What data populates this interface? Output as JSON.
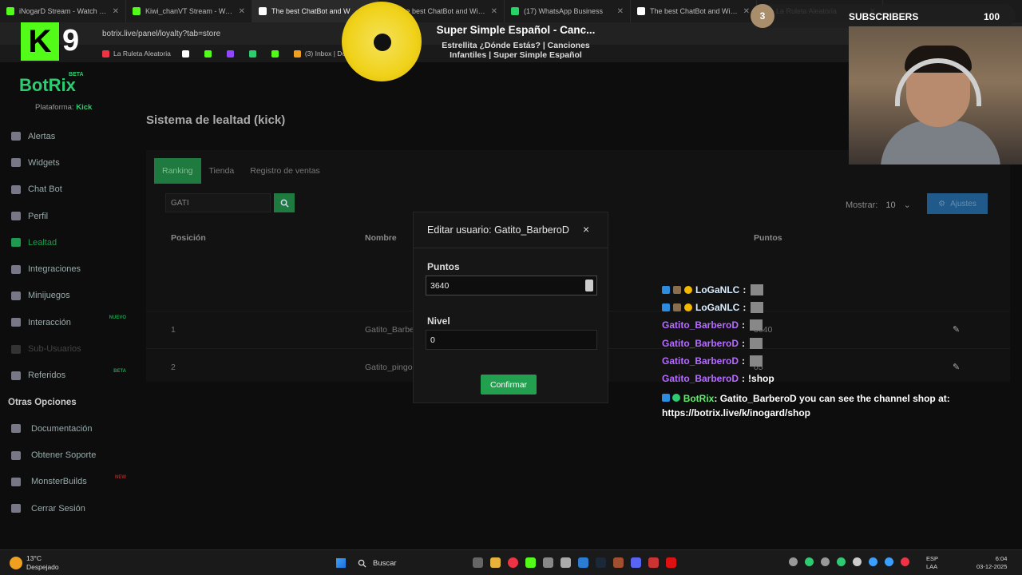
{
  "browser": {
    "tabs": [
      {
        "label": "iNogarD Stream - Watch Live o",
        "color": "#53fc18"
      },
      {
        "label": "Kiwi_chanVT Stream - Watch Li",
        "color": "#53fc18"
      },
      {
        "label": "The best ChatBot and W",
        "color": "#ffffff",
        "active": true
      },
      {
        "label": "The best ChatBot and Widgets",
        "color": "#ffffff"
      },
      {
        "label": "(17) WhatsApp Business",
        "color": "#25d366"
      },
      {
        "label": "The best ChatBot and Widge",
        "color": "#ffffff"
      },
      {
        "label": "La Ruleta Aleatoria",
        "color": "#e34"
      }
    ],
    "url": "botrix.live/panel/loyalty?tab=store",
    "bookmarks": [
      {
        "label": "La Ruleta Aleatoria",
        "color": "#e34"
      },
      {
        "label": "",
        "color": "#fff"
      },
      {
        "label": "",
        "color": "#53fc18"
      },
      {
        "label": "",
        "color": "#9146ff"
      },
      {
        "label": "",
        "color": "#2ecc71"
      },
      {
        "label": "",
        "color": "#53fc18"
      },
      {
        "label": "(3) Inbox | Donoclip",
        "color": "#f0a020"
      }
    ]
  },
  "sidebar": {
    "logo_letter": "K",
    "logo_number": "9",
    "brand": "BotRix",
    "beta": "BETA",
    "platform_label": "Plataforma:",
    "platform_value": "Kick",
    "items": [
      {
        "label": "Alertas",
        "badge": ""
      },
      {
        "label": "Widgets",
        "badge": ""
      },
      {
        "label": "Chat Bot",
        "badge": ""
      },
      {
        "label": "Perfil",
        "badge": ""
      },
      {
        "label": "Lealtad",
        "badge": ""
      },
      {
        "label": "Integraciones",
        "badge": ""
      },
      {
        "label": "Minijuegos",
        "badge": ""
      },
      {
        "label": "Interacción",
        "badge": "NUEVO"
      },
      {
        "label": "Sub-Usuarios",
        "badge": ""
      },
      {
        "label": "Referidos",
        "badge": "BETA"
      }
    ],
    "other_title": "Otras Opciones",
    "other_items": [
      {
        "label": "Documentación",
        "badge": ""
      },
      {
        "label": "Obtener Soporte",
        "badge": ""
      },
      {
        "label": "MonsterBuilds",
        "badge": "NEW"
      },
      {
        "label": "Cerrar Sesión",
        "badge": ""
      }
    ]
  },
  "main": {
    "title": "Sistema de lealtad (kick)",
    "tabs": [
      "Ranking",
      "Tienda",
      "Registro de ventas"
    ],
    "search_value": "GATI",
    "show_label": "Mostrar:",
    "show_value": "10",
    "settings_label": "Ajustes",
    "columns": [
      "Posición",
      "Nombre",
      "Puntos"
    ],
    "rows": [
      {
        "position": "1",
        "name": "Gatito_Barbe",
        "points": "3640"
      },
      {
        "position": "2",
        "name": "Gatito_pingo",
        "points": "05"
      }
    ]
  },
  "modal": {
    "title": "Editar usuario: Gatito_BarberoD",
    "close": "×",
    "points_label": "Puntos",
    "points_value": "3640",
    "level_label": "Nivel",
    "level_value": "0",
    "confirm_label": "Confirmar"
  },
  "overlay": {
    "now_playing_title": "Super Simple Español - Canc...",
    "now_playing_sub": "Estrellita ¿Dónde Estás? | Canciones Infantiles | Super Simple Español",
    "subs_count_left": "3",
    "subs_label": "SUBSCRIBERS",
    "subs_goal": "100",
    "chat": [
      {
        "user": "LoGaNLC",
        "sep": ":",
        "msg": "",
        "emote": true,
        "style": "loga",
        "badges": [
          "blue",
          "gray",
          "gold"
        ]
      },
      {
        "user": "LoGaNLC",
        "sep": ":",
        "msg": "",
        "emote": true,
        "style": "loga",
        "badges": [
          "blue",
          "gray",
          "gold"
        ]
      },
      {
        "user": "Gatito_BarberoD",
        "sep": ":",
        "msg": "",
        "emote": true,
        "style": "gatito",
        "badges": []
      },
      {
        "user": "Gatito_BarberoD",
        "sep": ":",
        "msg": "",
        "emote": true,
        "style": "gatito",
        "badges": []
      },
      {
        "user": "Gatito_BarberoD",
        "sep": ":",
        "msg": "",
        "emote": true,
        "style": "gatito",
        "badges": []
      },
      {
        "user": "Gatito_BarberoD",
        "sep": ":",
        "msg": "!shop",
        "emote": false,
        "style": "gatito",
        "badges": []
      }
    ],
    "bot_user": "BotRix",
    "bot_msg": ": Gatito_BarberoD you can see the channel shop at:",
    "bot_link": "https://botrix.live/k/inogard/shop"
  },
  "taskbar": {
    "temp": "13°C",
    "weather": "Despejado",
    "search": "Buscar",
    "lang1": "ESP",
    "lang2": "LAA",
    "time": "6:04",
    "date": "03-12-2025"
  },
  "colors": {
    "accent": "#23a04f",
    "bg": "#0d0d0d"
  }
}
